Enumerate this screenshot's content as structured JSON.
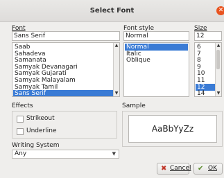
{
  "window": {
    "title": "Select Font"
  },
  "font": {
    "label": "Font",
    "value": "Sans Serif",
    "items": [
      "Saab",
      "Sahadeva",
      "Samanata",
      "Samyak Devanagari",
      "Samyak Gujarati",
      "Samyak Malayalam",
      "Samyak Tamil",
      "Sans Serif"
    ],
    "selected": "Sans Serif"
  },
  "style": {
    "label": "Font style",
    "value": "Normal",
    "items": [
      "Normal",
      "Italic",
      "Oblique"
    ],
    "selected": "Normal"
  },
  "size": {
    "label": "Size",
    "value": "12",
    "items": [
      "6",
      "7",
      "8",
      "9",
      "10",
      "11",
      "12",
      "14"
    ],
    "selected": "12"
  },
  "effects": {
    "label": "Effects",
    "strikeout": {
      "label": "Strikeout",
      "checked": false
    },
    "underline": {
      "label": "Underline",
      "checked": false
    }
  },
  "sample": {
    "label": "Sample",
    "text": "AaBbYyZz"
  },
  "writing_system": {
    "label": "Writing System",
    "value": "Any"
  },
  "buttons": {
    "cancel": "Cancel",
    "ok": "OK"
  },
  "colors": {
    "selection": "#3a7bd5",
    "close": "#e95420"
  }
}
